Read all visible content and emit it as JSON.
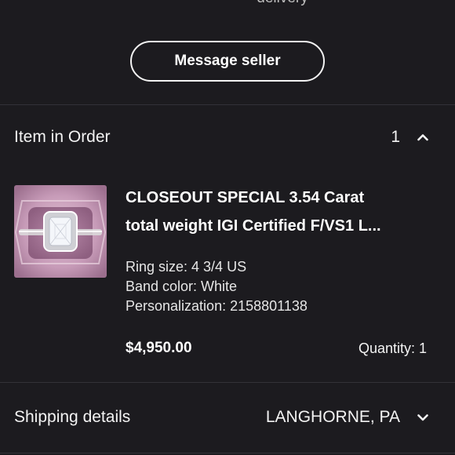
{
  "top": {
    "partial_text": "delivery"
  },
  "actions": {
    "message_seller": "Message seller"
  },
  "order": {
    "section_title": "Item in Order",
    "count": "1"
  },
  "item": {
    "title_line1": "CLOSEOUT SPECIAL  3.54 Carat",
    "title_line2": "total weight IGI Certified F/VS1 L...",
    "ring_size": "Ring size: 4 3/4 US",
    "band_color": "Band color: White",
    "personalization": "Personalization: 2158801138",
    "price": "$4,950.00",
    "quantity": "Quantity: 1",
    "thumbnail_icon": "ring-product-photo"
  },
  "shipping": {
    "section_title": "Shipping details",
    "location": "LANGHORNE, PA"
  },
  "colors": {
    "background": "#1c1b1f",
    "text": "#f3f3f3",
    "divider": "#333238",
    "thumb_pink": "#c79bb8"
  }
}
